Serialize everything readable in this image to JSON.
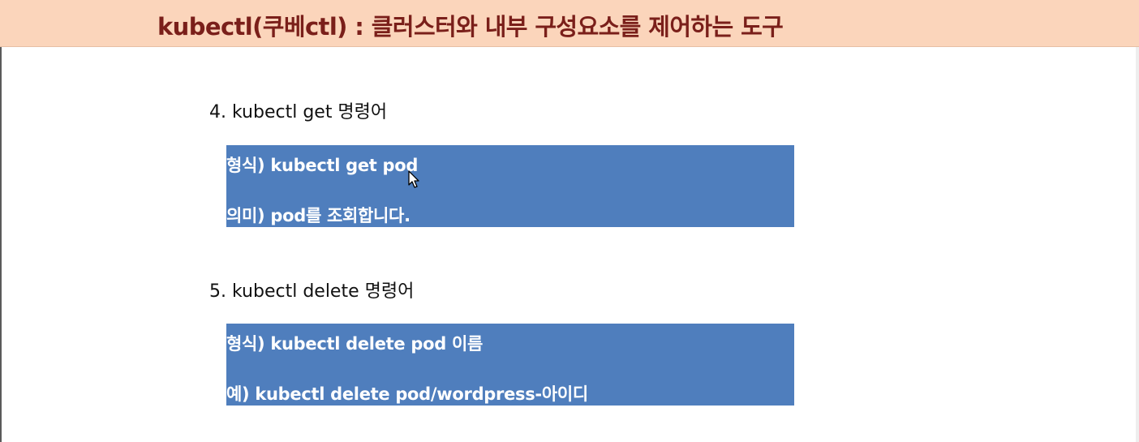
{
  "header": {
    "title": "kubectl(쿠베ctl) : 클러스터와 내부 구성요소를 제어하는 도구"
  },
  "sections": [
    {
      "heading": "4. kubectl get 명령어",
      "box_line_1": "형식) kubectl get pod",
      "box_line_2": "의미) pod를 조회합니다."
    },
    {
      "heading": "5. kubectl delete 명령어",
      "box_line_1": "형식) kubectl delete pod 이름",
      "box_line_2": "예) kubectl delete pod/wordpress-아이디"
    }
  ],
  "colors": {
    "header_background": "#fbd5bb",
    "header_text": "#7a1f1a",
    "box_background": "#4f7ebd",
    "box_text": "#ffffff"
  },
  "icons": {
    "cursor": "mouse-pointer-icon"
  }
}
